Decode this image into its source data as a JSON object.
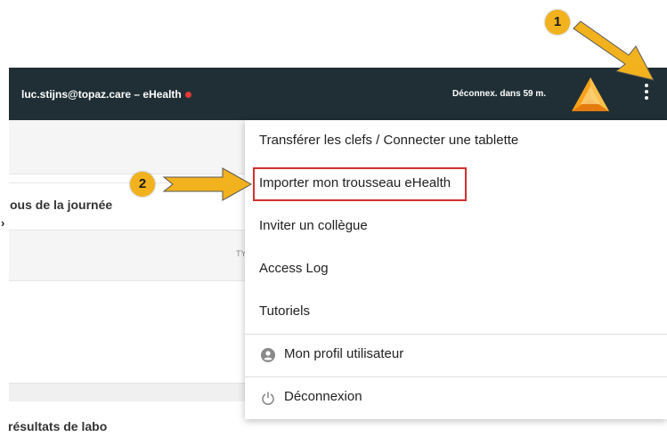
{
  "header": {
    "account": "luc.stijns@topaz.care – eHealth",
    "session": "Déconnex. dans 59 m."
  },
  "background": {
    "card1_title": "ous de la journée",
    "card1_col": "TY",
    "card2_title": "résultats de labo",
    "chevron": "›"
  },
  "menu": {
    "items": [
      {
        "label": "Transférer les clefs / Connecter une tablette"
      },
      {
        "label": "Importer mon trousseau eHealth"
      },
      {
        "label": "Inviter un collègue"
      },
      {
        "label": "Access Log"
      },
      {
        "label": "Tutoriels"
      },
      {
        "label": "Mon profil utilisateur",
        "icon": "account-circle-icon"
      },
      {
        "label": "Déconnexion",
        "icon": "power-icon"
      }
    ]
  },
  "annotations": {
    "step1": "1",
    "step2": "2"
  },
  "colors": {
    "header_bg": "#1f2f35",
    "highlight": "#d32f2f",
    "badge": "#f2b21e",
    "status_dot": "#e53935"
  }
}
